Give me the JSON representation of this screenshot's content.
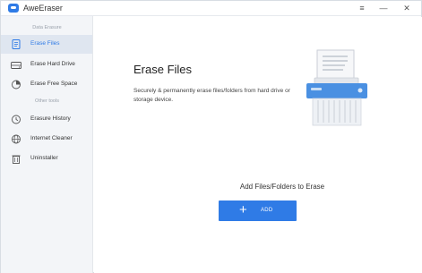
{
  "app": {
    "title": "AweEraser"
  },
  "window_controls": {
    "menu": "≡",
    "minimize": "—",
    "close": "✕"
  },
  "sidebar": {
    "section_erasure": "Data Erasure",
    "section_other": "Other tools",
    "items": [
      {
        "label": "Erase Files",
        "icon": "file-icon",
        "active": true
      },
      {
        "label": "Erase Hard Drive",
        "icon": "hard-drive-icon",
        "active": false
      },
      {
        "label": "Erase Free Space",
        "icon": "pie-chart-icon",
        "active": false
      },
      {
        "label": "Erasure History",
        "icon": "history-icon",
        "active": false
      },
      {
        "label": "Internet Cleaner",
        "icon": "globe-icon",
        "active": false
      },
      {
        "label": "Uninstaller",
        "icon": "trash-icon",
        "active": false
      }
    ]
  },
  "main": {
    "title": "Erase Files",
    "description": "Securely & permanently erase files/folders from hard drive or storage device.",
    "add_caption": "Add Files/Folders to Erase",
    "add_button": {
      "icon": "+",
      "label": "ADD"
    }
  },
  "colors": {
    "accent": "#2f7be6",
    "sidebar_bg": "#f3f5f8",
    "active_bg": "#dfe6f0"
  }
}
